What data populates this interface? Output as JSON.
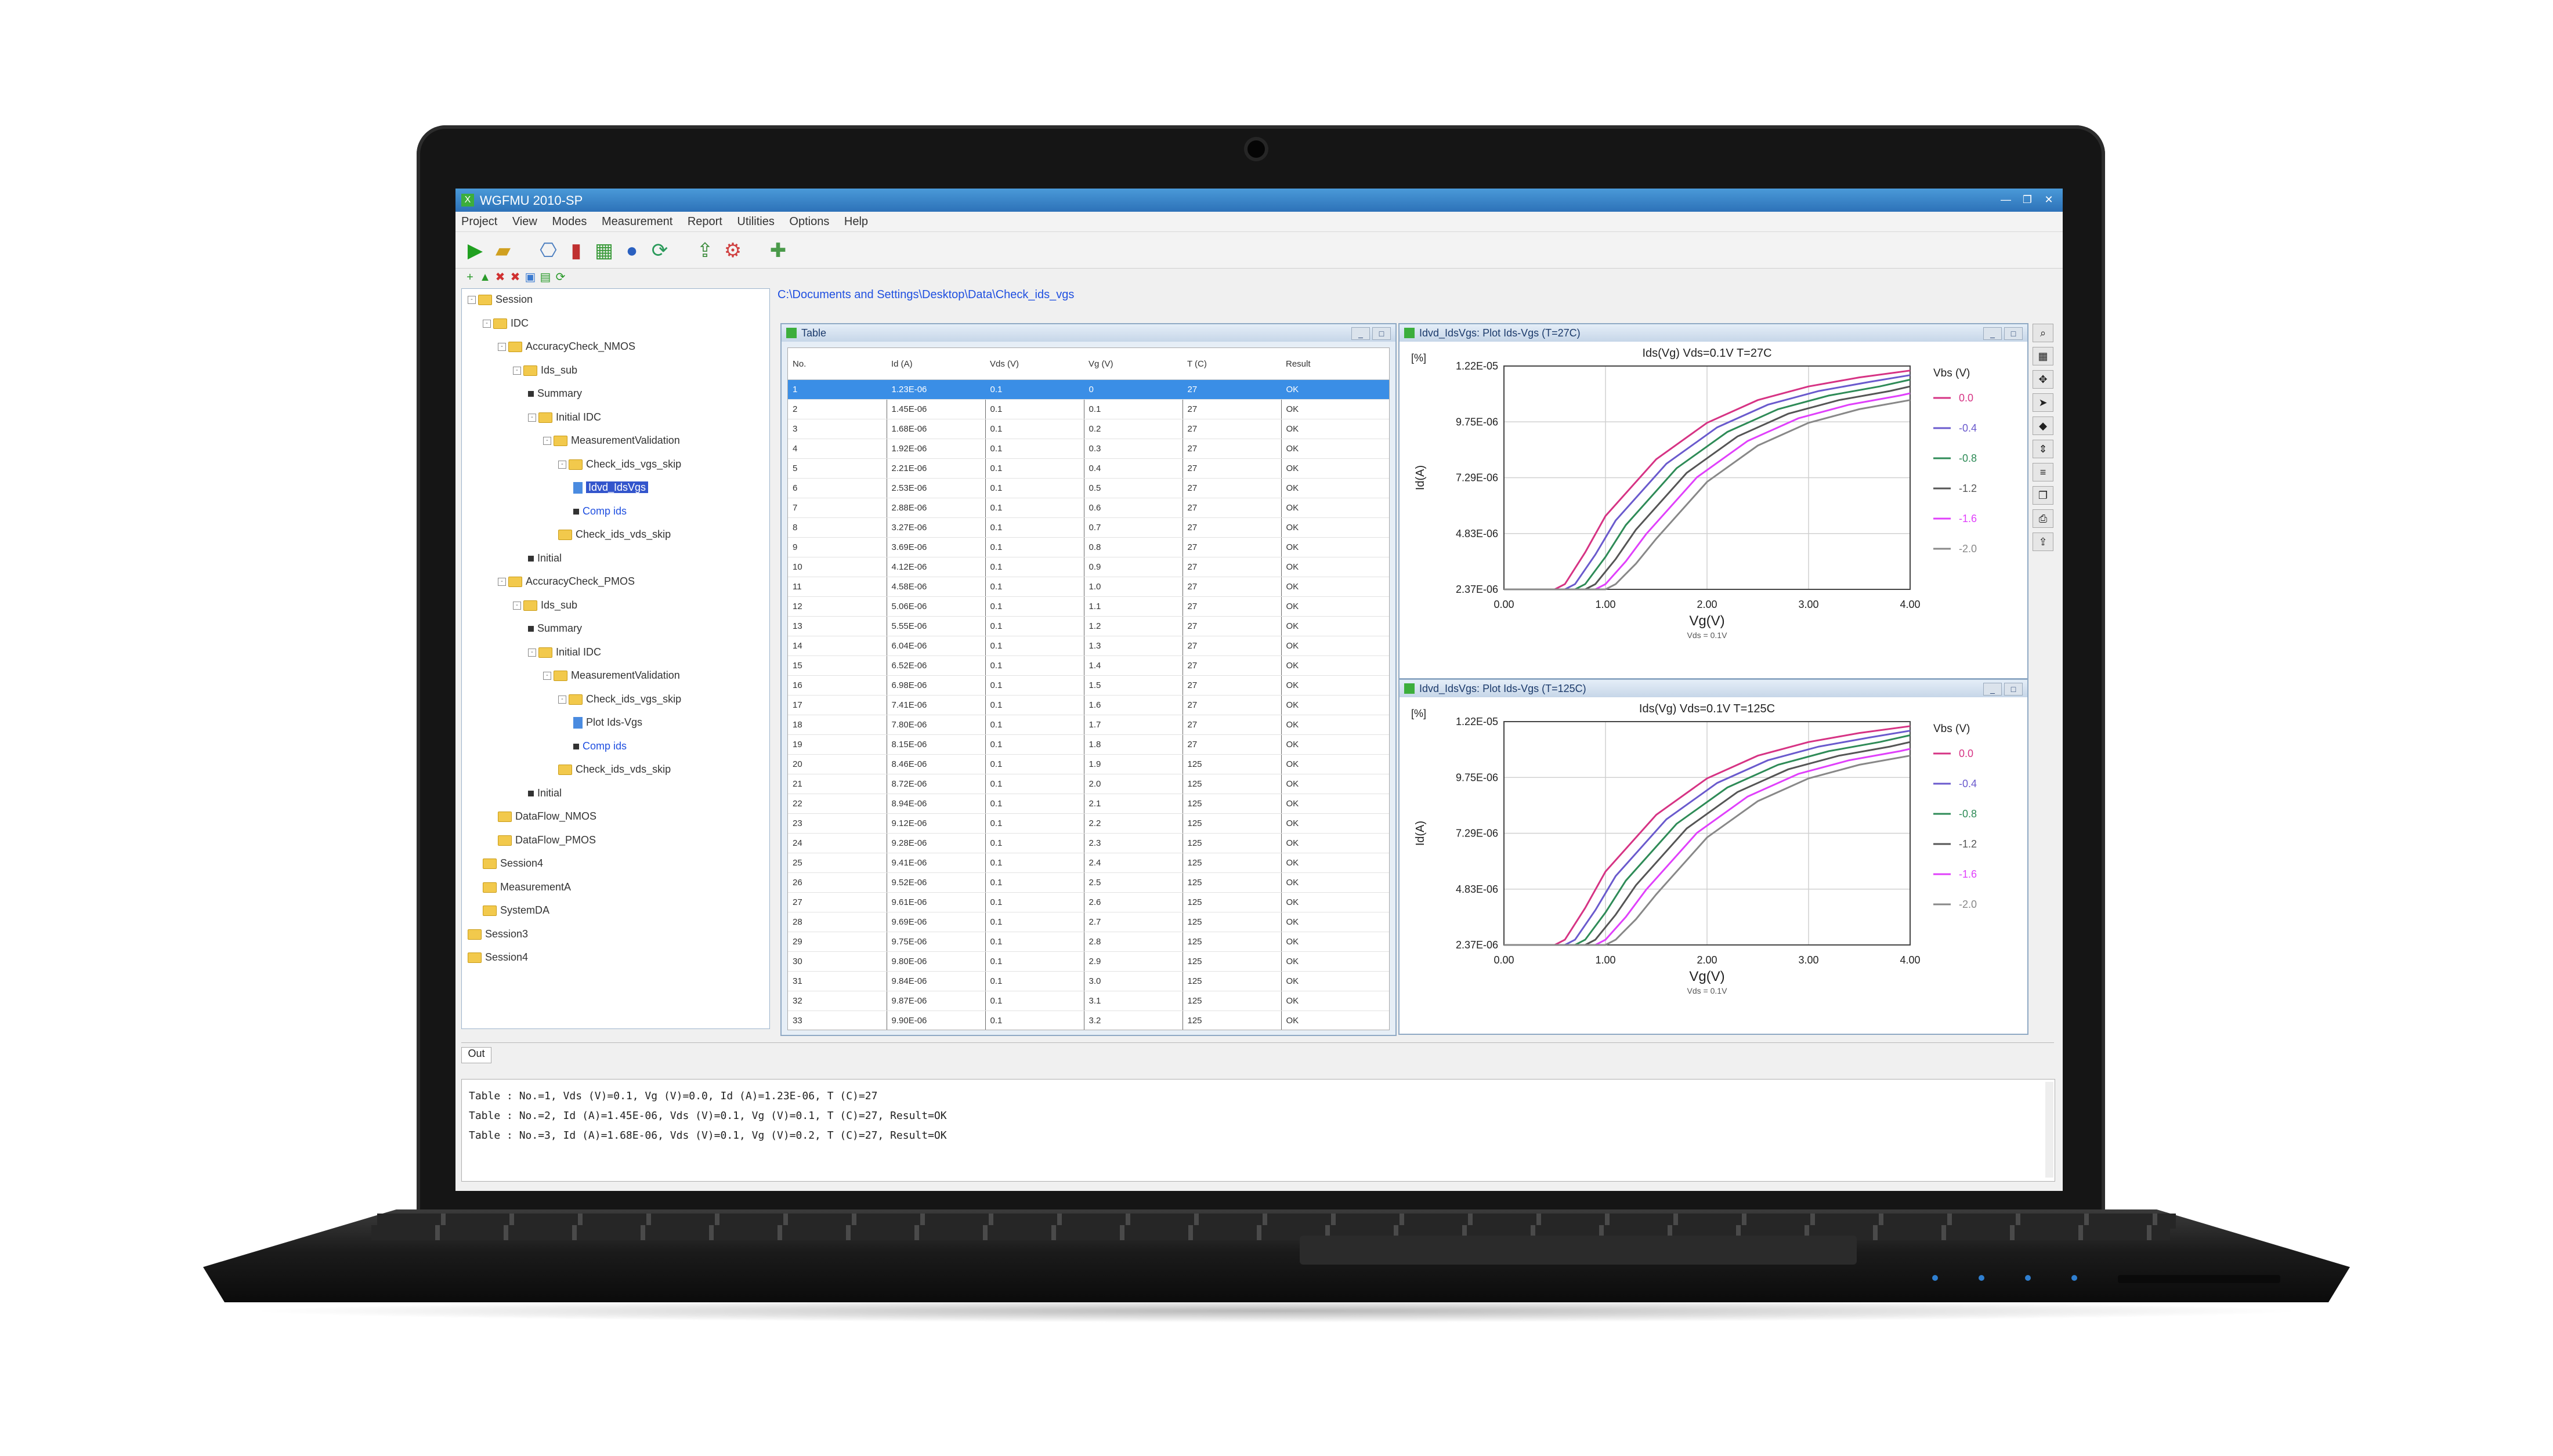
{
  "window": {
    "title": "WGFMU 2010-SP",
    "icon_label": "X",
    "controls": [
      "—",
      "❐",
      "✕"
    ]
  },
  "menu": [
    "Project",
    "View",
    "Modes",
    "Measurement",
    "Report",
    "Utilities",
    "Options",
    "Help"
  ],
  "toolbar_icons": [
    "run-icon",
    "folder-open-icon",
    "connect-icon",
    "bar-chart-icon",
    "chart-add-icon",
    "info-icon",
    "refresh-icon",
    "export-icon",
    "settings-icon",
    "plugin-icon"
  ],
  "tree_toolbar_icons": [
    "add-icon",
    "up-icon",
    "delete-icon",
    "copy-icon",
    "paste-icon",
    "save-icon",
    "refresh-icon"
  ],
  "tree": [
    {
      "label": "Session",
      "depth": 0,
      "kind": "folder",
      "expander": "-"
    },
    {
      "label": "IDC",
      "depth": 1,
      "kind": "folder",
      "expander": "-"
    },
    {
      "label": "AccuracyCheck_NMOS",
      "depth": 2,
      "kind": "folder",
      "expander": "-"
    },
    {
      "label": "Ids_sub",
      "depth": 3,
      "kind": "folder",
      "expander": "-"
    },
    {
      "label": "Summary",
      "depth": 4,
      "kind": "item",
      "expander": ""
    },
    {
      "label": "Initial IDC",
      "depth": 4,
      "kind": "folder",
      "expander": "-"
    },
    {
      "label": "MeasurementValidation",
      "depth": 5,
      "kind": "folder",
      "expander": "-"
    },
    {
      "label": "Check_ids_vgs_skip",
      "depth": 6,
      "kind": "folder",
      "expander": "-"
    },
    {
      "label": "Idvd_IdsVgs",
      "depth": 7,
      "kind": "leaf",
      "expander": "",
      "style": "selected"
    },
    {
      "label": "Comp ids",
      "depth": 7,
      "kind": "item",
      "expander": "",
      "style": "link"
    },
    {
      "label": "Check_ids_vds_skip",
      "depth": 6,
      "kind": "folder",
      "expander": ""
    },
    {
      "label": "Initial",
      "depth": 4,
      "kind": "item",
      "expander": ""
    },
    {
      "label": "AccuracyCheck_PMOS",
      "depth": 2,
      "kind": "folder",
      "expander": "-"
    },
    {
      "label": "Ids_sub",
      "depth": 3,
      "kind": "folder",
      "expander": "-"
    },
    {
      "label": "Summary",
      "depth": 4,
      "kind": "item",
      "expander": ""
    },
    {
      "label": "Initial IDC",
      "depth": 4,
      "kind": "folder",
      "expander": "-"
    },
    {
      "label": "MeasurementValidation",
      "depth": 5,
      "kind": "folder",
      "expander": "-"
    },
    {
      "label": "Check_ids_vgs_skip",
      "depth": 6,
      "kind": "folder",
      "expander": "-"
    },
    {
      "label": "Plot Ids-Vgs",
      "depth": 7,
      "kind": "leaf",
      "expander": ""
    },
    {
      "label": "Comp ids",
      "depth": 7,
      "kind": "item",
      "expander": "",
      "style": "link"
    },
    {
      "label": "Check_ids_vds_skip",
      "depth": 6,
      "kind": "folder",
      "expander": ""
    },
    {
      "label": "Initial",
      "depth": 4,
      "kind": "item",
      "expander": ""
    },
    {
      "label": "DataFlow_NMOS",
      "depth": 2,
      "kind": "folder",
      "expander": ""
    },
    {
      "label": "DataFlow_PMOS",
      "depth": 2,
      "kind": "folder",
      "expander": ""
    },
    {
      "label": "Session4",
      "depth": 1,
      "kind": "folder",
      "expander": ""
    },
    {
      "label": "MeasurementA",
      "depth": 1,
      "kind": "folder",
      "expander": ""
    },
    {
      "label": "SystemDA",
      "depth": 1,
      "kind": "folder",
      "expander": ""
    },
    {
      "label": "Session3",
      "depth": 0,
      "kind": "folder",
      "expander": ""
    },
    {
      "label": "Session4",
      "depth": 0,
      "kind": "folder",
      "expander": ""
    }
  ],
  "breadcrumb": "C:\\Documents and Settings\\Desktop\\Data\\Check_ids_vgs",
  "table_window": {
    "title": "Table",
    "columns": [
      "No.",
      "Id (A)",
      "Vds (V)",
      "Vg (V)",
      "T (C)",
      "Result"
    ],
    "rows": [
      [
        "1",
        "1.23E-06",
        "0.1",
        "0",
        "27",
        "OK"
      ],
      [
        "2",
        "1.45E-06",
        "0.1",
        "0.1",
        "27",
        "OK"
      ],
      [
        "3",
        "1.68E-06",
        "0.1",
        "0.2",
        "27",
        "OK"
      ],
      [
        "4",
        "1.92E-06",
        "0.1",
        "0.3",
        "27",
        "OK"
      ],
      [
        "5",
        "2.21E-06",
        "0.1",
        "0.4",
        "27",
        "OK"
      ],
      [
        "6",
        "2.53E-06",
        "0.1",
        "0.5",
        "27",
        "OK"
      ],
      [
        "7",
        "2.88E-06",
        "0.1",
        "0.6",
        "27",
        "OK"
      ],
      [
        "8",
        "3.27E-06",
        "0.1",
        "0.7",
        "27",
        "OK"
      ],
      [
        "9",
        "3.69E-06",
        "0.1",
        "0.8",
        "27",
        "OK"
      ],
      [
        "10",
        "4.12E-06",
        "0.1",
        "0.9",
        "27",
        "OK"
      ],
      [
        "11",
        "4.58E-06",
        "0.1",
        "1.0",
        "27",
        "OK"
      ],
      [
        "12",
        "5.06E-06",
        "0.1",
        "1.1",
        "27",
        "OK"
      ],
      [
        "13",
        "5.55E-06",
        "0.1",
        "1.2",
        "27",
        "OK"
      ],
      [
        "14",
        "6.04E-06",
        "0.1",
        "1.3",
        "27",
        "OK"
      ],
      [
        "15",
        "6.52E-06",
        "0.1",
        "1.4",
        "27",
        "OK"
      ],
      [
        "16",
        "6.98E-06",
        "0.1",
        "1.5",
        "27",
        "OK"
      ],
      [
        "17",
        "7.41E-06",
        "0.1",
        "1.6",
        "27",
        "OK"
      ],
      [
        "18",
        "7.80E-06",
        "0.1",
        "1.7",
        "27",
        "OK"
      ],
      [
        "19",
        "8.15E-06",
        "0.1",
        "1.8",
        "27",
        "OK"
      ],
      [
        "20",
        "8.46E-06",
        "0.1",
        "1.9",
        "125",
        "OK"
      ],
      [
        "21",
        "8.72E-06",
        "0.1",
        "2.0",
        "125",
        "OK"
      ],
      [
        "22",
        "8.94E-06",
        "0.1",
        "2.1",
        "125",
        "OK"
      ],
      [
        "23",
        "9.12E-06",
        "0.1",
        "2.2",
        "125",
        "OK"
      ],
      [
        "24",
        "9.28E-06",
        "0.1",
        "2.3",
        "125",
        "OK"
      ],
      [
        "25",
        "9.41E-06",
        "0.1",
        "2.4",
        "125",
        "OK"
      ],
      [
        "26",
        "9.52E-06",
        "0.1",
        "2.5",
        "125",
        "OK"
      ],
      [
        "27",
        "9.61E-06",
        "0.1",
        "2.6",
        "125",
        "OK"
      ],
      [
        "28",
        "9.69E-06",
        "0.1",
        "2.7",
        "125",
        "OK"
      ],
      [
        "29",
        "9.75E-06",
        "0.1",
        "2.8",
        "125",
        "OK"
      ],
      [
        "30",
        "9.80E-06",
        "0.1",
        "2.9",
        "125",
        "OK"
      ],
      [
        "31",
        "9.84E-06",
        "0.1",
        "3.0",
        "125",
        "OK"
      ],
      [
        "32",
        "9.87E-06",
        "0.1",
        "3.1",
        "125",
        "OK"
      ],
      [
        "33",
        "9.90E-06",
        "0.1",
        "3.2",
        "125",
        "OK"
      ]
    ],
    "active_row": 0
  },
  "chart_windows": [
    {
      "title": "Idvd_IdsVgs: Plot Ids-Vgs (T=27C)"
    },
    {
      "title": "Idvd_IdsVgs: Plot Ids-Vgs (T=125C)"
    }
  ],
  "chart_data": [
    {
      "type": "line",
      "title": "Ids(Vg) Vds=0.1V T=27C",
      "ylabel": "Id(A)",
      "xlabel": "Vg(V)",
      "x_sublabel": "Vds = 0.1V",
      "yunit_tag": "[%]",
      "xlim": [
        0,
        4
      ],
      "ylim": [
        2.37e-06,
        1.22e-05
      ],
      "xticks": [
        "0.00",
        "1.00",
        "2.00",
        "3.00",
        "4.00"
      ],
      "yticks": [
        "1.22E-05",
        "9.75E-06",
        "7.29E-06",
        "4.83E-06",
        "2.37E-06"
      ],
      "legend_title": "Vbs (V)",
      "legend_position": "right",
      "series": [
        {
          "name": "0.0",
          "color": "#d63384",
          "x": [
            0,
            0.5,
            0.6,
            0.8,
            1.0,
            1.5,
            2.0,
            2.5,
            3.0,
            3.5,
            4.0
          ],
          "y": [
            2.37e-06,
            2.37e-06,
            2.6e-06,
            4e-06,
            5.6e-06,
            8.1e-06,
            9.7e-06,
            1.07e-05,
            1.13e-05,
            1.17e-05,
            1.2e-05
          ]
        },
        {
          "name": "-0.4",
          "color": "#6a5acd",
          "x": [
            0,
            0.6,
            0.7,
            0.9,
            1.1,
            1.6,
            2.1,
            2.6,
            3.1,
            3.6,
            4.0
          ],
          "y": [
            2.37e-06,
            2.37e-06,
            2.6e-06,
            3.9e-06,
            5.4e-06,
            7.9e-06,
            9.5e-06,
            1.05e-05,
            1.11e-05,
            1.15e-05,
            1.18e-05
          ]
        },
        {
          "name": "-0.8",
          "color": "#2e8b57",
          "x": [
            0,
            0.7,
            0.8,
            1.0,
            1.2,
            1.7,
            2.2,
            2.7,
            3.2,
            3.7,
            4.0
          ],
          "y": [
            2.37e-06,
            2.37e-06,
            2.6e-06,
            3.8e-06,
            5.2e-06,
            7.7e-06,
            9.3e-06,
            1.03e-05,
            1.09e-05,
            1.13e-05,
            1.16e-05
          ]
        },
        {
          "name": "-1.2",
          "color": "#555555",
          "x": [
            0,
            0.8,
            0.9,
            1.1,
            1.3,
            1.8,
            2.3,
            2.8,
            3.3,
            3.8,
            4.0
          ],
          "y": [
            2.37e-06,
            2.37e-06,
            2.6e-06,
            3.7e-06,
            5e-06,
            7.5e-06,
            9.1e-06,
            1.01e-05,
            1.07e-05,
            1.11e-05,
            1.13e-05
          ]
        },
        {
          "name": "-1.6",
          "color": "#e040fb",
          "x": [
            0,
            0.9,
            1.0,
            1.2,
            1.4,
            1.9,
            2.4,
            2.9,
            3.4,
            3.9,
            4.0
          ],
          "y": [
            2.37e-06,
            2.37e-06,
            2.6e-06,
            3.6e-06,
            4.8e-06,
            7.3e-06,
            8.9e-06,
            9.9e-06,
            1.05e-05,
            1.09e-05,
            1.1e-05
          ]
        },
        {
          "name": "-2.0",
          "color": "#888888",
          "x": [
            0,
            1.0,
            1.1,
            1.3,
            1.5,
            2.0,
            2.5,
            3.0,
            3.5,
            4.0
          ],
          "y": [
            2.37e-06,
            2.37e-06,
            2.6e-06,
            3.5e-06,
            4.6e-06,
            7.1e-06,
            8.7e-06,
            9.7e-06,
            1.03e-05,
            1.07e-05
          ]
        }
      ]
    },
    {
      "type": "line",
      "title": "Ids(Vg) Vds=0.1V T=125C",
      "ylabel": "Id(A)",
      "xlabel": "Vg(V)",
      "x_sublabel": "Vds = 0.1V",
      "yunit_tag": "[%]",
      "xlim": [
        0,
        4
      ],
      "ylim": [
        2.37e-06,
        1.22e-05
      ],
      "xticks": [
        "0.00",
        "1.00",
        "2.00",
        "3.00",
        "4.00"
      ],
      "yticks": [
        "1.22E-05",
        "9.75E-06",
        "7.29E-06",
        "4.83E-06",
        "2.37E-06"
      ],
      "legend_title": "Vbs (V)",
      "legend_position": "right",
      "series": [
        {
          "name": "0.0",
          "color": "#d63384",
          "x": [
            0,
            0.5,
            0.6,
            0.8,
            1.0,
            1.5,
            2.0,
            2.5,
            3.0,
            3.5,
            4.0
          ],
          "y": [
            2.37e-06,
            2.37e-06,
            2.6e-06,
            4e-06,
            5.6e-06,
            8.1e-06,
            9.7e-06,
            1.07e-05,
            1.13e-05,
            1.17e-05,
            1.2e-05
          ]
        },
        {
          "name": "-0.4",
          "color": "#6a5acd",
          "x": [
            0,
            0.6,
            0.7,
            0.9,
            1.1,
            1.6,
            2.1,
            2.6,
            3.1,
            3.6,
            4.0
          ],
          "y": [
            2.37e-06,
            2.37e-06,
            2.6e-06,
            3.9e-06,
            5.4e-06,
            7.9e-06,
            9.5e-06,
            1.05e-05,
            1.11e-05,
            1.15e-05,
            1.18e-05
          ]
        },
        {
          "name": "-0.8",
          "color": "#2e8b57",
          "x": [
            0,
            0.7,
            0.8,
            1.0,
            1.2,
            1.7,
            2.2,
            2.7,
            3.2,
            3.7,
            4.0
          ],
          "y": [
            2.37e-06,
            2.37e-06,
            2.6e-06,
            3.8e-06,
            5.2e-06,
            7.7e-06,
            9.3e-06,
            1.03e-05,
            1.09e-05,
            1.13e-05,
            1.16e-05
          ]
        },
        {
          "name": "-1.2",
          "color": "#555555",
          "x": [
            0,
            0.8,
            0.9,
            1.1,
            1.3,
            1.8,
            2.3,
            2.8,
            3.3,
            3.8,
            4.0
          ],
          "y": [
            2.37e-06,
            2.37e-06,
            2.6e-06,
            3.7e-06,
            5e-06,
            7.5e-06,
            9.1e-06,
            1.01e-05,
            1.07e-05,
            1.11e-05,
            1.13e-05
          ]
        },
        {
          "name": "-1.6",
          "color": "#e040fb",
          "x": [
            0,
            0.9,
            1.0,
            1.2,
            1.4,
            1.9,
            2.4,
            2.9,
            3.4,
            3.9,
            4.0
          ],
          "y": [
            2.37e-06,
            2.37e-06,
            2.6e-06,
            3.6e-06,
            4.8e-06,
            7.3e-06,
            8.9e-06,
            9.9e-06,
            1.05e-05,
            1.09e-05,
            1.1e-05
          ]
        },
        {
          "name": "-2.0",
          "color": "#888888",
          "x": [
            0,
            1.0,
            1.1,
            1.3,
            1.5,
            2.0,
            2.5,
            3.0,
            3.5,
            4.0
          ],
          "y": [
            2.37e-06,
            2.37e-06,
            2.6e-06,
            3.5e-06,
            4.6e-06,
            7.1e-06,
            8.7e-06,
            9.7e-06,
            1.03e-05,
            1.07e-05
          ]
        }
      ]
    }
  ],
  "side_strip_icons": [
    "zoom-icon",
    "grid-icon",
    "pan-icon",
    "cursor-icon",
    "marker-icon",
    "scale-icon",
    "legend-icon",
    "copy-icon",
    "print-icon",
    "export-icon"
  ],
  "console": {
    "tab_label": "Out",
    "lines": [
      "Table : No.=1, Vds (V)=0.1, Vg (V)=0.0, Id (A)=1.23E-06, T (C)=27",
      "Table : No.=2, Id (A)=1.45E-06, Vds (V)=0.1, Vg (V)=0.1, T (C)=27, Result=OK",
      "Table : No.=3, Id (A)=1.68E-06, Vds (V)=0.1, Vg (V)=0.2, T (C)=27, Result=OK"
    ]
  }
}
